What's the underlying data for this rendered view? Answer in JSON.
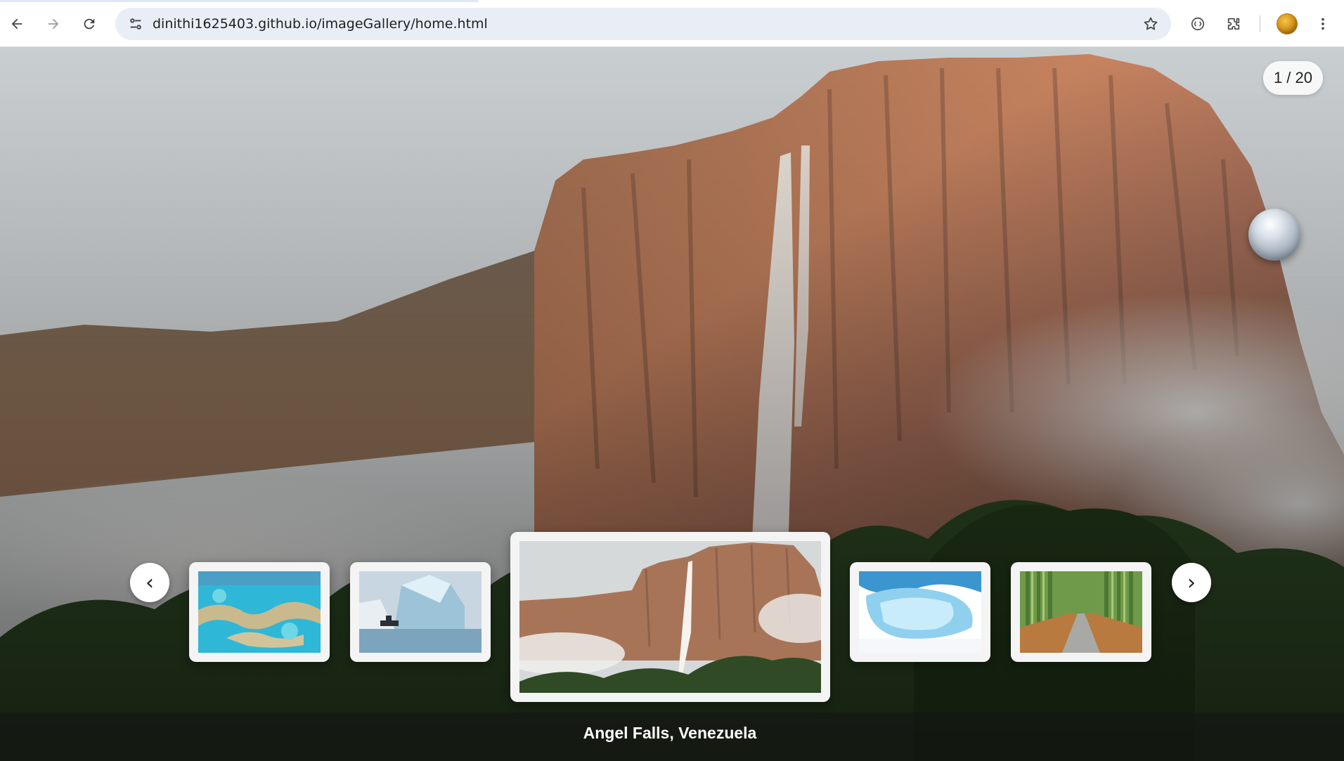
{
  "browser": {
    "url": "dinithi1625403.github.io/imageGallery/home.html"
  },
  "gallery": {
    "counter": "1 / 20",
    "prev_label": "‹",
    "next_label": "›",
    "caption": "Angel Falls, Venezuela",
    "current_index": 1,
    "total": 20
  }
}
